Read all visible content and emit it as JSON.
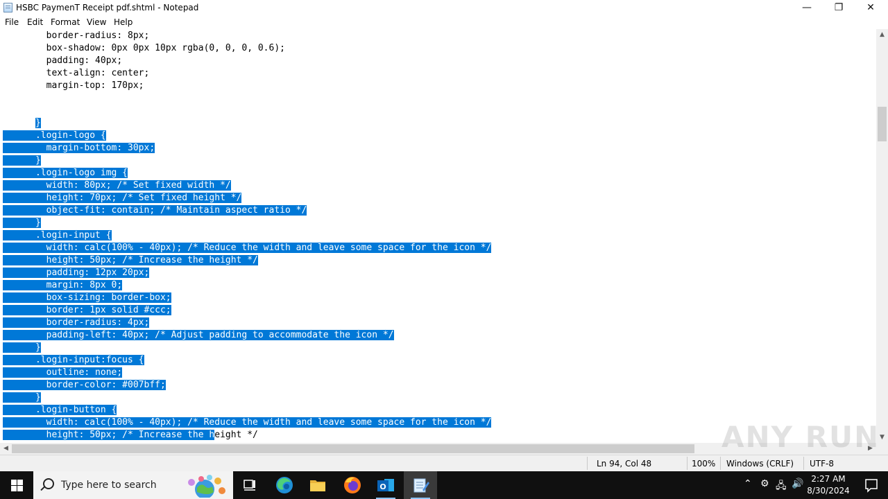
{
  "window": {
    "title": "HSBC PaymenT Receipt pdf.shtml - Notepad",
    "minimize": "—",
    "maximize": "❐",
    "close": "✕"
  },
  "menu": [
    "File",
    "Edit",
    "Format",
    "View",
    "Help"
  ],
  "editor": {
    "lines": [
      {
        "text": "        border-radius: 8px;",
        "sel": ""
      },
      {
        "text": "        box-shadow: 0px 0px 10px rgba(0, 0, 0, 0.6);",
        "sel": ""
      },
      {
        "text": "        padding: 40px;",
        "sel": ""
      },
      {
        "text": "        text-align: center;",
        "sel": ""
      },
      {
        "text": "        margin-top: 170px;",
        "sel": ""
      },
      {
        "text": "",
        "sel": ""
      },
      {
        "text": "",
        "sel": ""
      },
      {
        "text": "      ",
        "sel": "}"
      },
      {
        "text": "",
        "sel": "      .login-logo {"
      },
      {
        "text": "",
        "sel": "        margin-bottom: 30px;"
      },
      {
        "text": "",
        "sel": "      }"
      },
      {
        "text": "",
        "sel": "      .login-logo img {"
      },
      {
        "text": "",
        "sel": "        width: 80px; /* Set fixed width */"
      },
      {
        "text": "",
        "sel": "        height: 70px; /* Set fixed height */"
      },
      {
        "text": "",
        "sel": "        object-fit: contain; /* Maintain aspect ratio */"
      },
      {
        "text": "",
        "sel": "      }"
      },
      {
        "text": "",
        "sel": "      .login-input {"
      },
      {
        "text": "",
        "sel": "        width: calc(100% - 40px); /* Reduce the width and leave some space for the icon */"
      },
      {
        "text": "",
        "sel": "        height: 50px; /* Increase the height */"
      },
      {
        "text": "",
        "sel": "        padding: 12px 20px;"
      },
      {
        "text": "",
        "sel": "        margin: 8px 0;"
      },
      {
        "text": "",
        "sel": "        box-sizing: border-box;"
      },
      {
        "text": "",
        "sel": "        border: 1px solid #ccc;"
      },
      {
        "text": "",
        "sel": "        border-radius: 4px;"
      },
      {
        "text": "",
        "sel": "        padding-left: 40px; /* Adjust padding to accommodate the icon */"
      },
      {
        "text": "",
        "sel": "      }"
      },
      {
        "text": "",
        "sel": "      .login-input:focus {"
      },
      {
        "text": "",
        "sel": "        outline: none;"
      },
      {
        "text": "",
        "sel": "        border-color: #007bff;"
      },
      {
        "text": "",
        "sel": "      }"
      },
      {
        "text": "",
        "sel": "      .login-button {"
      },
      {
        "text": "",
        "sel": "        width: calc(100% - 40px); /* Reduce the width and leave some space for the icon */"
      },
      {
        "text": "",
        "sel": "        height: 50px; /* Increase the h",
        "after": "eight */"
      }
    ]
  },
  "status": {
    "position": "Ln 94, Col 48",
    "zoom": "100%",
    "line_ending": "Windows (CRLF)",
    "encoding": "UTF-8"
  },
  "watermark": "ANY RUN",
  "taskbar": {
    "search_placeholder": "Type here to search",
    "time": "2:27 AM",
    "date": "8/30/2024"
  },
  "colors": {
    "selection": "#0078d7",
    "taskbar": "#101010"
  }
}
